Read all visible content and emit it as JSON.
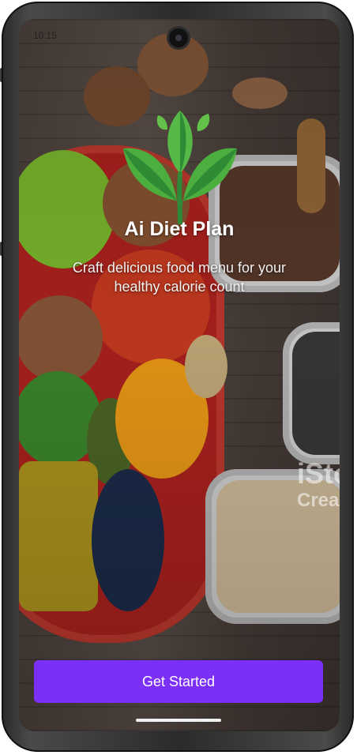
{
  "status_bar": {
    "time": "10:15"
  },
  "hero": {
    "title": "Ai Diet Plan",
    "subtitle": "Craft delicious food menu for your healthy calorie count"
  },
  "watermark": {
    "line1": "iSto",
    "line2": "Crea"
  },
  "actions": {
    "get_started_label": "Get Started"
  },
  "colors": {
    "accent": "#7b2ff7",
    "title_text": "#ffffff",
    "platter_red": "#b3231f",
    "leaf_green": "#3f9a3a"
  },
  "icons": {
    "logo": "leaf-sprout-icon",
    "camera": "front-camera-icon",
    "home": "home-indicator"
  }
}
